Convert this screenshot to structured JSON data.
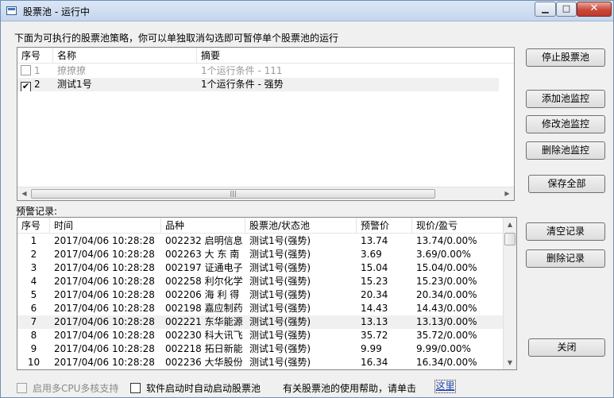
{
  "window": {
    "title": "股票池 - 运行中",
    "min_glyph": "▁",
    "max_glyph": "□",
    "close_glyph": "✕"
  },
  "strategy": {
    "description": "下面为可执行的股票池策略，你可以单独取消勾选即可暂停单个股票池的运行",
    "headers": [
      "序号",
      "名称",
      "摘要"
    ],
    "rows": [
      {
        "checked": false,
        "index": "1",
        "name": "撩撩撩",
        "summary": "1个运行条件 - 111",
        "dimmed": true
      },
      {
        "checked": true,
        "index": "2",
        "name": "测试1号",
        "summary": "1个运行条件 - 强势",
        "dimmed": false
      }
    ],
    "scroll_left": "◀",
    "scroll_right": "▶",
    "scroll_grip": "|||"
  },
  "alerts": {
    "label": "预警记录:",
    "headers": [
      "序号",
      "时间",
      "品种",
      "股票池/状态池",
      "预警价",
      "现价/盈亏"
    ],
    "rows": [
      {
        "index": "1",
        "time": "2017/04/06 10:28:28",
        "stock": "002232 启明信息",
        "pool": "测试1号(强势)",
        "price": "13.74",
        "current": "13.74/0.00%"
      },
      {
        "index": "2",
        "time": "2017/04/06 10:28:28",
        "stock": "002263 大 东 南",
        "pool": "测试1号(强势)",
        "price": "3.69",
        "current": "3.69/0.00%"
      },
      {
        "index": "3",
        "time": "2017/04/06 10:28:28",
        "stock": "002197 证通电子",
        "pool": "测试1号(强势)",
        "price": "15.04",
        "current": "15.04/0.00%"
      },
      {
        "index": "4",
        "time": "2017/04/06 10:28:28",
        "stock": "002258 利尔化学",
        "pool": "测试1号(强势)",
        "price": "15.23",
        "current": "15.23/0.00%"
      },
      {
        "index": "5",
        "time": "2017/04/06 10:28:28",
        "stock": "002206 海 利 得",
        "pool": "测试1号(强势)",
        "price": "20.34",
        "current": "20.34/0.00%"
      },
      {
        "index": "6",
        "time": "2017/04/06 10:28:28",
        "stock": "002198 嘉应制药",
        "pool": "测试1号(强势)",
        "price": "14.43",
        "current": "14.43/0.00%"
      },
      {
        "index": "7",
        "time": "2017/04/06 10:28:28",
        "stock": "002221 东华能源",
        "pool": "测试1号(强势)",
        "price": "13.13",
        "current": "13.13/0.00%"
      },
      {
        "index": "8",
        "time": "2017/04/06 10:28:28",
        "stock": "002230 科大讯飞",
        "pool": "测试1号(强势)",
        "price": "35.72",
        "current": "35.72/0.00%"
      },
      {
        "index": "9",
        "time": "2017/04/06 10:28:28",
        "stock": "002218 拓日新能",
        "pool": "测试1号(强势)",
        "price": "9.99",
        "current": "9.99/0.00%"
      },
      {
        "index": "10",
        "time": "2017/04/06 10:28:28",
        "stock": "002236 大华股份",
        "pool": "测试1号(强势)",
        "price": "16.34",
        "current": "16.34/0.00%"
      }
    ],
    "scroll_up": "▲",
    "scroll_down": "▼"
  },
  "buttons": {
    "stop": "停止股票池",
    "add_monitor": "添加池监控",
    "edit_monitor": "修改池监控",
    "delete_monitor": "删除池监控",
    "save_all": "保存全部",
    "clear_records": "清空记录",
    "delete_records": "删除记录",
    "close": "关闭"
  },
  "footer": {
    "multi_cpu": "启用多CPU多核支持",
    "auto_start": "软件启动时自动启动股票池",
    "help_text": "有关股票池的使用帮助，请单击",
    "help_link": "这里"
  }
}
